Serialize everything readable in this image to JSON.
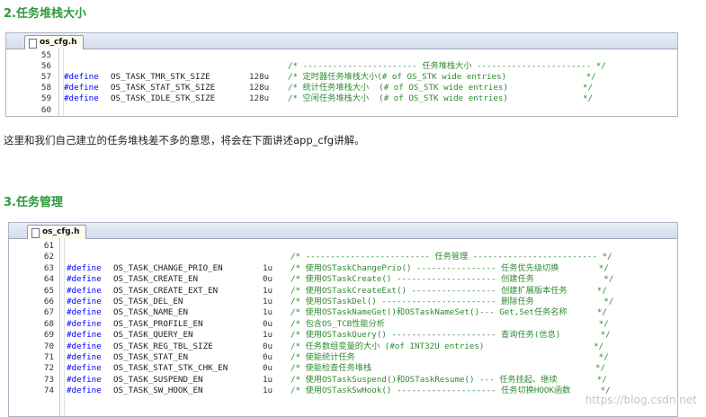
{
  "section1": {
    "heading": "2.任务堆栈大小",
    "tab": "os_cfg.h",
    "lines": [
      {
        "n": "55",
        "def": "",
        "mac": "",
        "val": "",
        "cmt": ""
      },
      {
        "n": "56",
        "def": "",
        "mac": "",
        "val": "",
        "cmt": "/* ----------------------- 任务堆栈大小 ----------------------- */"
      },
      {
        "n": "57",
        "def": "#define",
        "mac": "OS_TASK_TMR_STK_SIZE",
        "val": "128u",
        "cmt": "/* 定时器任务堆栈大小(# of OS_STK wide entries)                */"
      },
      {
        "n": "58",
        "def": "#define",
        "mac": "OS_TASK_STAT_STK_SIZE",
        "val": "128u",
        "cmt": "/* 统计任务堆栈大小  (# of OS_STK wide entries)               */"
      },
      {
        "n": "59",
        "def": "#define",
        "mac": "OS_TASK_IDLE_STK_SIZE",
        "val": "128u",
        "cmt": "/* 空闲任务堆栈大小  (# of OS_STK wide entries)               */"
      },
      {
        "n": "60",
        "def": "",
        "mac": "",
        "val": "",
        "cmt": ""
      }
    ]
  },
  "paragraph": "这里和我们自己建立的任务堆栈差不多的意思，将会在下面讲述app_cfg讲解。",
  "section2": {
    "heading": "3.任务管理",
    "tab": "os_cfg.h",
    "lines": [
      {
        "n": "61",
        "def": "",
        "mac": "",
        "val": "",
        "cmt": ""
      },
      {
        "n": "62",
        "def": "",
        "mac": "",
        "val": "",
        "cmt": "/* ------------------------- 任务管理 ------------------------- */"
      },
      {
        "n": "63",
        "def": "#define",
        "mac": "OS_TASK_CHANGE_PRIO_EN",
        "val": "1u",
        "cmt": "/* 使用OSTaskChangePrio() ---------------- 任务优先级切换        */"
      },
      {
        "n": "64",
        "def": "#define",
        "mac": "OS_TASK_CREATE_EN",
        "val": "0u",
        "cmt": "/* 使用OSTaskCreate() -------------------- 创建任务              */"
      },
      {
        "n": "65",
        "def": "#define",
        "mac": "OS_TASK_CREATE_EXT_EN",
        "val": "1u",
        "cmt": "/* 使用OSTaskCreateExt() ----------------- 创建扩展版本任务      */"
      },
      {
        "n": "66",
        "def": "#define",
        "mac": "OS_TASK_DEL_EN",
        "val": "1u",
        "cmt": "/* 使用OSTaskDel() ----------------------- 删除任务              */"
      },
      {
        "n": "67",
        "def": "#define",
        "mac": "OS_TASK_NAME_EN",
        "val": "1u",
        "cmt": "/* 使用OSTaskNameGet()和OSTaskNameSet()--- Get,Set任务名称      */"
      },
      {
        "n": "68",
        "def": "#define",
        "mac": "OS_TASK_PROFILE_EN",
        "val": "0u",
        "cmt": "/* 包含OS_TCB性能分析                                           */"
      },
      {
        "n": "69",
        "def": "#define",
        "mac": "OS_TASK_QUERY_EN",
        "val": "1u",
        "cmt": "/* 使用OSTaskQuery() --------------------- 查询任务(信息)        */"
      },
      {
        "n": "70",
        "def": "#define",
        "mac": "OS_TASK_REG_TBL_SIZE",
        "val": "0u",
        "cmt": "/* 任务数组变量的大小 (#of INT32U entries)                      */"
      },
      {
        "n": "71",
        "def": "#define",
        "mac": "OS_TASK_STAT_EN",
        "val": "0u",
        "cmt": "/* 使能统计任务                                                 */"
      },
      {
        "n": "72",
        "def": "#define",
        "mac": "OS_TASK_STAT_STK_CHK_EN",
        "val": "0u",
        "cmt": "/* 使能检查任务堆栈                                             */"
      },
      {
        "n": "73",
        "def": "#define",
        "mac": "OS_TASK_SUSPEND_EN",
        "val": "1u",
        "cmt": "/* 使用OSTaskSuspend()和OSTaskResume() --- 任务挂起、继续        */"
      },
      {
        "n": "74",
        "def": "#define",
        "mac": "OS_TASK_SW_HOOK_EN",
        "val": "1u",
        "cmt": "/* 使用OSTaskSwHook() -------------------- 任务切换HOOK函数      */"
      }
    ]
  },
  "watermark": "https://blog.csdn.net"
}
